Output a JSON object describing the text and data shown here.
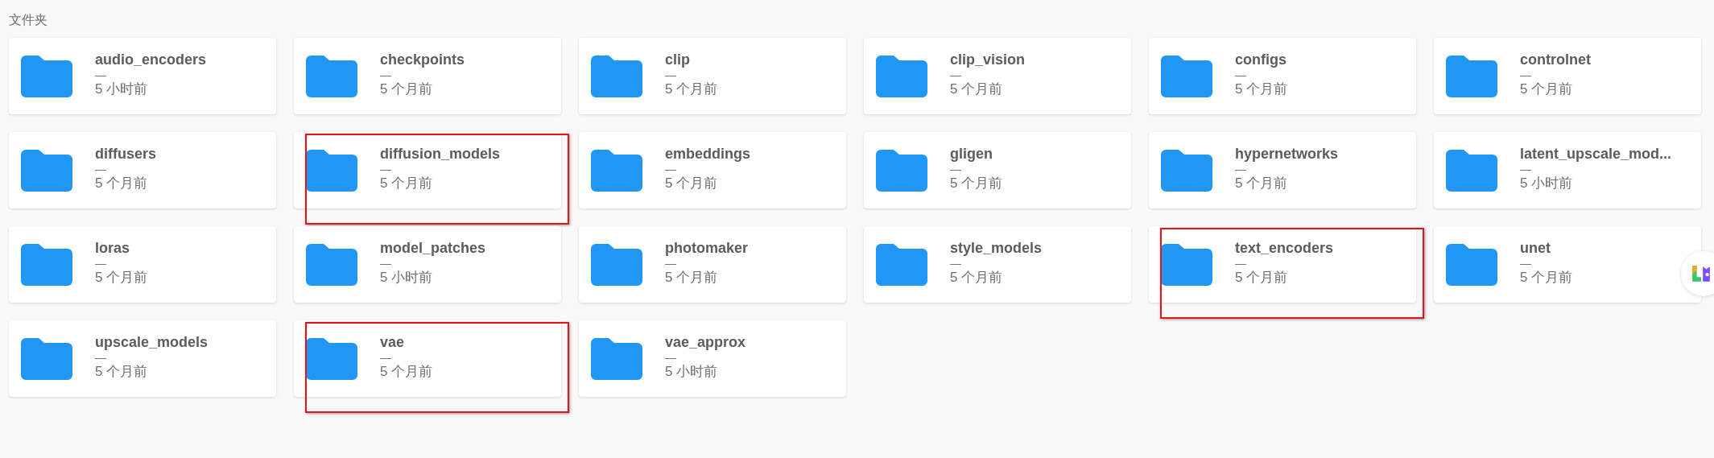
{
  "section_title": "文件夹",
  "folders": [
    {
      "name": "audio_encoders",
      "size": "—",
      "modified": "5 小时前",
      "highlighted": false
    },
    {
      "name": "checkpoints",
      "size": "—",
      "modified": "5 个月前",
      "highlighted": false
    },
    {
      "name": "clip",
      "size": "—",
      "modified": "5 个月前",
      "highlighted": false
    },
    {
      "name": "clip_vision",
      "size": "—",
      "modified": "5 个月前",
      "highlighted": false
    },
    {
      "name": "configs",
      "size": "—",
      "modified": "5 个月前",
      "highlighted": false
    },
    {
      "name": "controlnet",
      "size": "—",
      "modified": "5 个月前",
      "highlighted": false
    },
    {
      "name": "diffusers",
      "size": "—",
      "modified": "5 个月前",
      "highlighted": false
    },
    {
      "name": "diffusion_models",
      "size": "—",
      "modified": "5 个月前",
      "highlighted": true
    },
    {
      "name": "embeddings",
      "size": "—",
      "modified": "5 个月前",
      "highlighted": false
    },
    {
      "name": "gligen",
      "size": "—",
      "modified": "5 个月前",
      "highlighted": false
    },
    {
      "name": "hypernetworks",
      "size": "—",
      "modified": "5 个月前",
      "highlighted": false
    },
    {
      "name": "latent_upscale_mod...",
      "size": "—",
      "modified": "5 小时前",
      "highlighted": false
    },
    {
      "name": "loras",
      "size": "—",
      "modified": "5 个月前",
      "highlighted": false
    },
    {
      "name": "model_patches",
      "size": "—",
      "modified": "5 小时前",
      "highlighted": false
    },
    {
      "name": "photomaker",
      "size": "—",
      "modified": "5 个月前",
      "highlighted": false
    },
    {
      "name": "style_models",
      "size": "—",
      "modified": "5 个月前",
      "highlighted": false
    },
    {
      "name": "text_encoders",
      "size": "—",
      "modified": "5 个月前",
      "highlighted": true
    },
    {
      "name": "unet",
      "size": "—",
      "modified": "5 个月前",
      "highlighted": false
    },
    {
      "name": "upscale_models",
      "size": "—",
      "modified": "5 个月前",
      "highlighted": false
    },
    {
      "name": "vae",
      "size": "—",
      "modified": "5 个月前",
      "highlighted": true
    },
    {
      "name": "vae_approx",
      "size": "—",
      "modified": "5 小时前",
      "highlighted": false
    }
  ]
}
